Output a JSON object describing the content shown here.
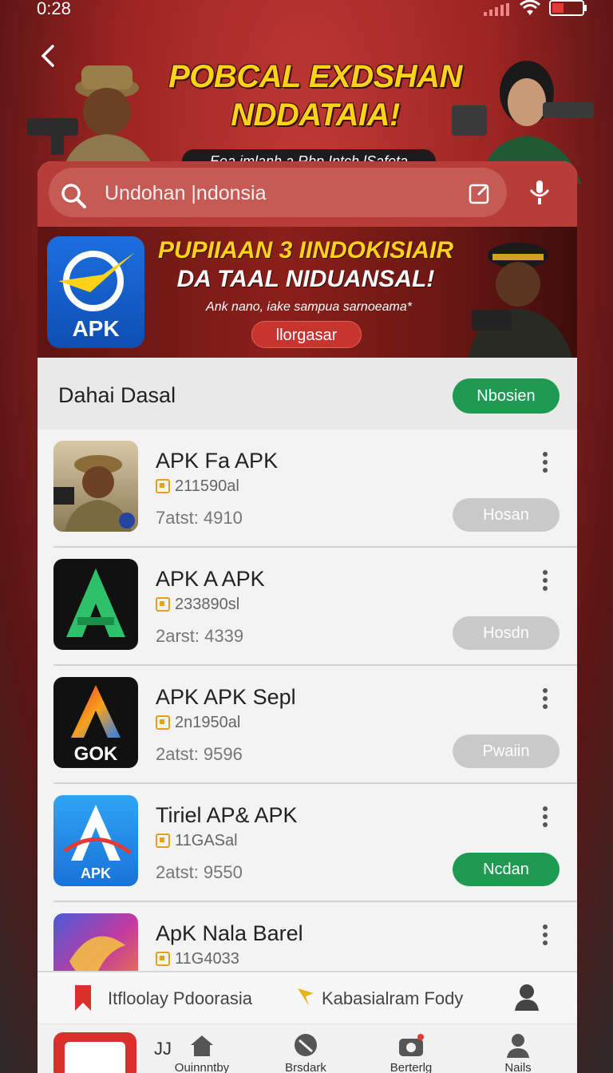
{
  "status": {
    "time": "0:28"
  },
  "hero": {
    "title_line1": "POBCAL EXDSHAN",
    "title_line2": "NDDATAIA!",
    "subtitle": "Eea imlanh a Rbp Intch lSafeta"
  },
  "search": {
    "text": "Undohan |ndonsia"
  },
  "banner": {
    "title_line1": "PUPIIAAN 3 IINDOKISIAIR",
    "title_line2": "DA TAAL NIDUANSAL!",
    "description": "Ank nano, iake sampua sarnoeama*",
    "button": "llorgasar",
    "logo_text": "APK"
  },
  "section": {
    "title": "Dahai Dasal",
    "button": "Nbosien"
  },
  "apps": [
    {
      "name": "APK Fa APK",
      "size": "211590al",
      "rating": "7atst: 4910",
      "action": "Hosan",
      "action_style": "grey"
    },
    {
      "name": "APK A APK",
      "size": "233890sl",
      "rating": "2arst: 4339",
      "action": "Hosdn",
      "action_style": "grey"
    },
    {
      "name": "APK APK Sepl",
      "size": "2n1950al",
      "rating": "2atst: 9596",
      "action": "Pwaiin",
      "action_style": "grey",
      "thumb_text": "GOK"
    },
    {
      "name": "Tiriel AP& APK",
      "size": "11GASal",
      "rating": "2atst: 9550",
      "action": "Ncdan",
      "action_style": "green",
      "thumb_text": "APK"
    },
    {
      "name": "ApK Nala Barel",
      "size": "11G4033",
      "rating": "",
      "action": "",
      "action_style": "grey"
    }
  ],
  "tabs": {
    "tab1": "Itfloolay Pdoorasia",
    "tab2": "Kabasialram Fody"
  },
  "bottom_nav": {
    "jj": "JJ",
    "items": [
      "Ouinnntby",
      "Brsdark",
      "Berterlg",
      "Nails"
    ]
  },
  "colors": {
    "accent_red": "#b73d39",
    "green": "#1e9a52",
    "gold": "#ffd21a"
  }
}
